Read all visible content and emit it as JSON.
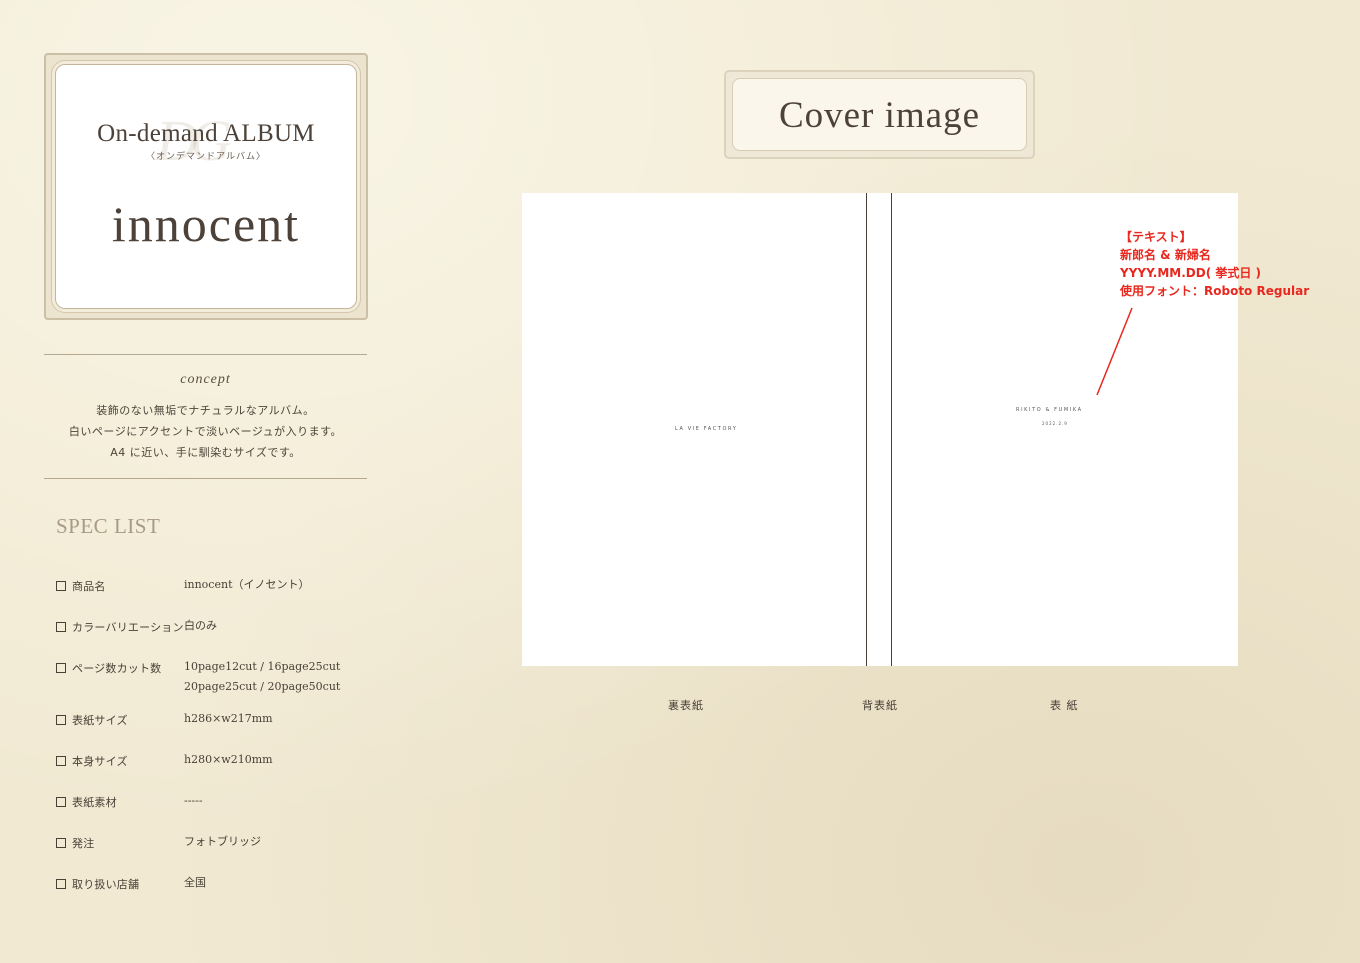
{
  "album": {
    "title": "On-demand ALBUM",
    "subtitle": "〈オンデマンドアルバム〉",
    "name": "innocent"
  },
  "concept": {
    "heading": "concept",
    "lines": [
      "装飾のない無垢でナチュラルなアルバム。",
      "白いページにアクセントで淡いベージュが入ります。",
      "A4 に近い、手に馴染むサイズです。"
    ]
  },
  "spec": {
    "heading": "SPEC LIST",
    "rows": [
      {
        "label": "商品名",
        "value": "innocent（イノセント）",
        "value2": ""
      },
      {
        "label": "カラーバリエーション",
        "value": "白のみ",
        "value2": ""
      },
      {
        "label": "ページ数カット数",
        "value": "10page12cut / 16page25cut",
        "value2": "20page25cut / 20page50cut"
      },
      {
        "label": "表紙サイズ",
        "value": "h286×w217mm",
        "value2": ""
      },
      {
        "label": "本身サイズ",
        "value": "h280×w210mm",
        "value2": ""
      },
      {
        "label": "表紙素材",
        "value": "-----",
        "value2": ""
      },
      {
        "label": "発注",
        "value": "フォトブリッジ",
        "value2": ""
      },
      {
        "label": "取り扱い店舗",
        "value": "全国",
        "value2": ""
      }
    ]
  },
  "cover": {
    "heading": "Cover image",
    "back_logo": "LA VIE FACTORY",
    "front_names": "RIKITO & FUMIKA",
    "front_date": "2022.2.9",
    "annotation": [
      "【テキスト】",
      "新郎名 & 新婦名",
      "YYYY.MM.DD( 挙式日 )",
      "使用フォント：Roboto Regular"
    ],
    "annotation_color": "#e8281e",
    "labels": {
      "back": "裏表紙",
      "spine": "背表紙",
      "front": "表 紙"
    }
  }
}
